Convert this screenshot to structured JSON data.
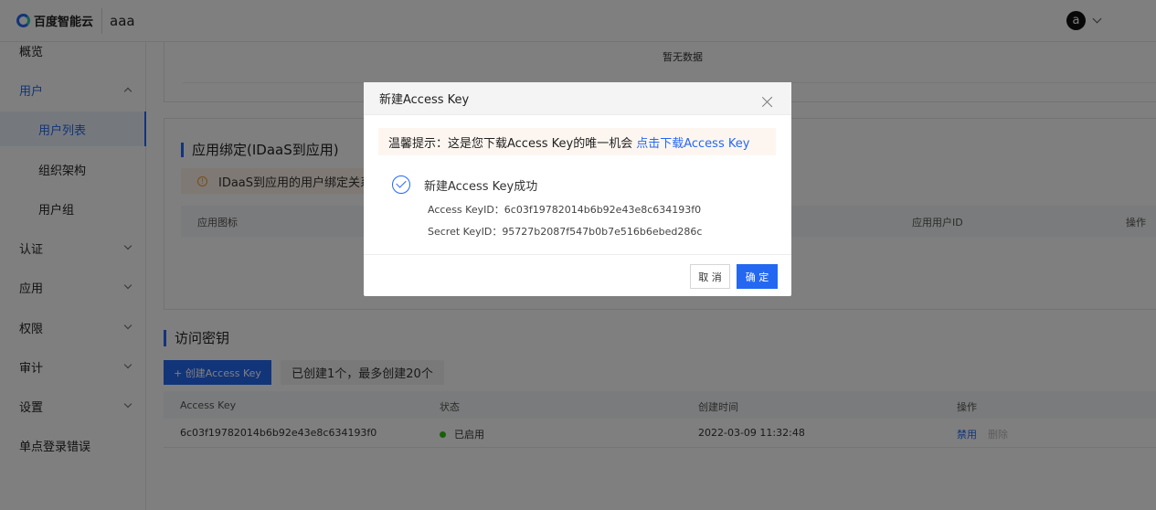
{
  "header": {
    "logo_text": "百度智能云",
    "app_name": "aaa",
    "avatar_letter": "a"
  },
  "sidebar": {
    "items": [
      {
        "label": "概览"
      },
      {
        "label": "用户"
      },
      {
        "label": "用户列表"
      },
      {
        "label": "组织架构"
      },
      {
        "label": "用户组"
      },
      {
        "label": "认证"
      },
      {
        "label": "应用"
      },
      {
        "label": "权限"
      },
      {
        "label": "审计"
      },
      {
        "label": "设置"
      },
      {
        "label": "单点登录错误"
      }
    ]
  },
  "main": {
    "empty_text": "暂无数据",
    "app_binding": {
      "title": "应用绑定(IDaaS到应用)",
      "warning": "IDaaS到应用的用户绑定关系",
      "columns": [
        "应用图标",
        "应用用户ID",
        "操作"
      ]
    },
    "access_keys": {
      "title": "访问密钥",
      "create_button": "+ 创建Access Key",
      "quota": "已创建1个，最多创建20个",
      "columns": [
        "Access Key",
        "状态",
        "创建时间",
        "操作"
      ],
      "rows": [
        {
          "key": "6c03f19782014b6b92e43e8c634193f0",
          "status": "已启用",
          "created": "2022-03-09 11:32:48",
          "action_disable": "禁用",
          "action_delete": "删除"
        }
      ]
    }
  },
  "dialog": {
    "title": "新建Access Key",
    "tip": "温馨提示：这是您下载Access Key的唯一机会",
    "tip_link": "点击下载Access Key",
    "success": "新建Access Key成功",
    "access_key_line": "Access KeyID：6c03f19782014b6b92e43e8c634193f0",
    "secret_key_line": "Secret KeyID：95727b2087f547b0b7e516b6ebed286c",
    "cancel": "取 消",
    "ok": "确 定"
  },
  "colors": {
    "primary": "#2468f2",
    "success": "#30bf13",
    "warning": "#f39a2b"
  }
}
